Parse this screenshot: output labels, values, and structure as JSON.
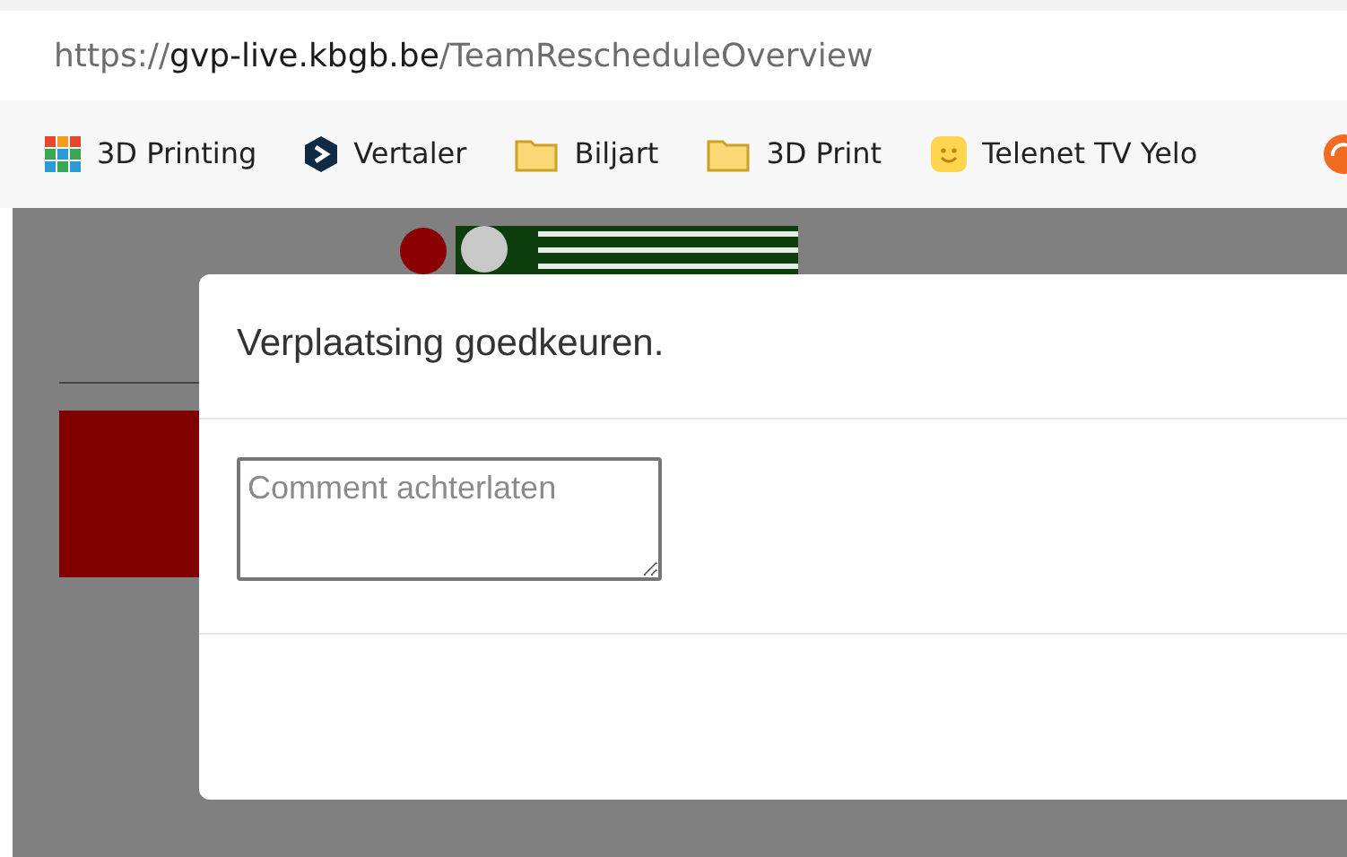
{
  "address_bar": {
    "scheme": "https://",
    "host": "gvp-live.kbgb.be",
    "path": "/TeamRescheduleOverview"
  },
  "bookmarks": [
    {
      "kind": "blocks",
      "label": "3D Printing"
    },
    {
      "kind": "hexagon",
      "label": "Vertaler"
    },
    {
      "kind": "folder",
      "label": "Biljart"
    },
    {
      "kind": "folder",
      "label": "3D Print"
    },
    {
      "kind": "smiley",
      "label": "Telenet TV Yelo"
    },
    {
      "kind": "orange-circle"
    }
  ],
  "modal": {
    "title": "Verplaatsing goedkeuren.",
    "comment": {
      "placeholder": "Comment achterlaten"
    }
  }
}
